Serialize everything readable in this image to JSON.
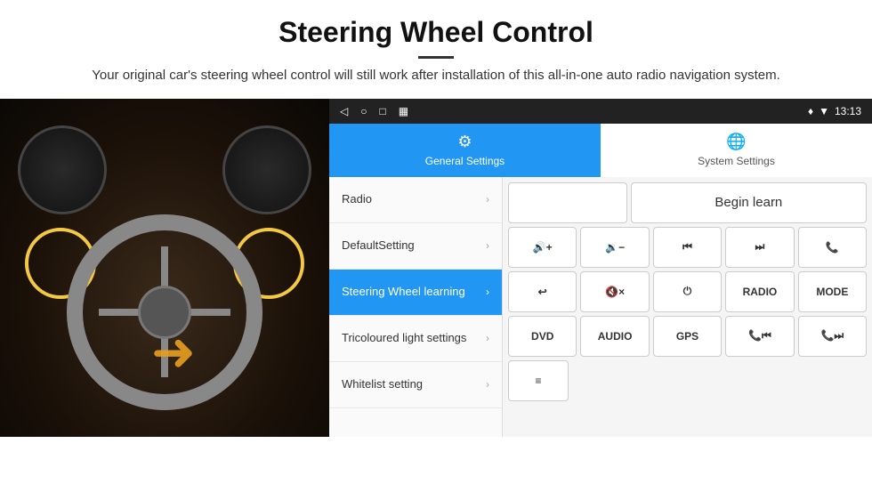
{
  "header": {
    "title": "Steering Wheel Control",
    "subtitle": "Your original car's steering wheel control will still work after installation of this all-in-one auto radio navigation system."
  },
  "statusBar": {
    "nav_back": "◁",
    "nav_home": "○",
    "nav_recent": "□",
    "nav_screenshot": "▦",
    "time": "13:13",
    "signal": "▼",
    "wifi": "♦"
  },
  "tabs": [
    {
      "id": "general",
      "label": "General Settings",
      "active": true
    },
    {
      "id": "system",
      "label": "System Settings",
      "active": false
    }
  ],
  "menu": {
    "items": [
      {
        "id": "radio",
        "label": "Radio",
        "active": false
      },
      {
        "id": "default",
        "label": "DefaultSetting",
        "active": false
      },
      {
        "id": "steering",
        "label": "Steering Wheel learning",
        "active": true
      },
      {
        "id": "tricoloured",
        "label": "Tricoloured light settings",
        "active": false
      },
      {
        "id": "whitelist",
        "label": "Whitelist setting",
        "active": false
      }
    ]
  },
  "controls": {
    "begin_learn": "Begin learn",
    "row1": [
      {
        "id": "vol_up",
        "label": "🔊+"
      },
      {
        "id": "vol_down",
        "label": "🔉−"
      },
      {
        "id": "prev",
        "label": "⏮"
      },
      {
        "id": "next",
        "label": "⏭"
      },
      {
        "id": "phone",
        "label": "📞"
      }
    ],
    "row2": [
      {
        "id": "hangup",
        "label": "↩"
      },
      {
        "id": "mute",
        "label": "🔇×"
      },
      {
        "id": "power",
        "label": "⏻"
      },
      {
        "id": "radio_btn",
        "label": "RADIO"
      },
      {
        "id": "mode",
        "label": "MODE"
      }
    ],
    "row3": [
      {
        "id": "dvd",
        "label": "DVD"
      },
      {
        "id": "audio",
        "label": "AUDIO"
      },
      {
        "id": "gps",
        "label": "GPS"
      },
      {
        "id": "tel_prev",
        "label": "📞⏮"
      },
      {
        "id": "tel_next",
        "label": "📞⏭"
      }
    ],
    "row4": [
      {
        "id": "list_icon",
        "label": "≡"
      }
    ]
  }
}
